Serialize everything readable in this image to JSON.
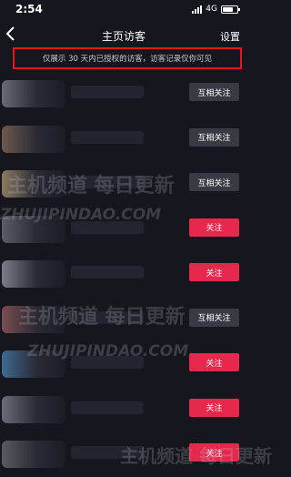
{
  "status_bar": {
    "time": "2:54",
    "network": "4G",
    "battery_level": 0.75
  },
  "nav": {
    "title": "主页访客",
    "settings_label": "设置"
  },
  "notice": "仅展示 30 天内已授权的访客，访客记录仅你可见",
  "visitors": [
    {
      "button": "互相关注",
      "kind": "mutual",
      "tint": "#6a6a74"
    },
    {
      "button": "互相关注",
      "kind": "mutual",
      "tint": "#6e5a4e"
    },
    {
      "button": "互相关注",
      "kind": "mutual",
      "tint": "#8a7a62"
    },
    {
      "button": "关注",
      "kind": "follow",
      "tint": "#5c5c68"
    },
    {
      "button": "关注",
      "kind": "follow",
      "tint": "#7c7c86"
    },
    {
      "button": "互相关注",
      "kind": "mutual",
      "tint": "#7c4e52"
    },
    {
      "button": "关注",
      "kind": "follow",
      "tint": "#3e6a92"
    },
    {
      "button": "关注",
      "kind": "follow",
      "tint": "#6c6c78"
    },
    {
      "button": "关注",
      "kind": "follow",
      "tint": "#5a5a62"
    }
  ],
  "watermarks": [
    {
      "text": "主机频道 每日更新"
    },
    {
      "text": "ZHUJIPINDAO.COM"
    },
    {
      "text": "主机频道 每日更新"
    },
    {
      "text": "ZHUJIPINDAO.COM"
    },
    {
      "text": "主机频道 每日更新"
    }
  ]
}
